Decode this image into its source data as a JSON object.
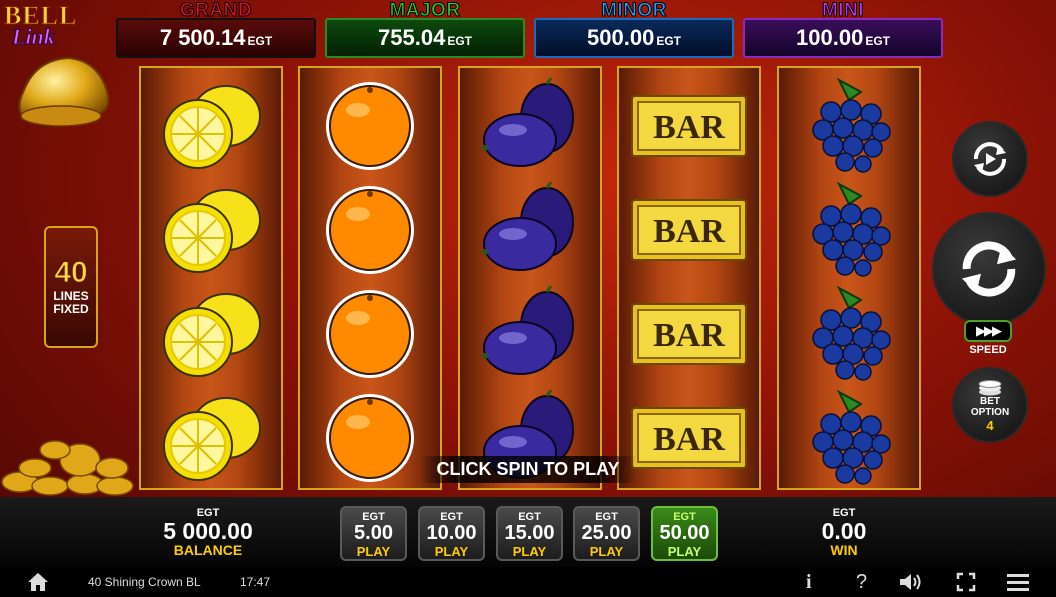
{
  "logo": {
    "line1": "BELL",
    "line2": "Link"
  },
  "jackpots": [
    {
      "name": "GRAND",
      "value": "7 500.14",
      "currency": "EGT",
      "label_color": "#e0102a",
      "bg": "#4a0808"
    },
    {
      "name": "MAJOR",
      "value": "755.04",
      "currency": "EGT",
      "label_color": "#2ad02a",
      "bg": "#0b3a0b"
    },
    {
      "name": "MINOR",
      "value": "500.00",
      "currency": "EGT",
      "label_color": "#1aa0ff",
      "bg": "#08224a"
    },
    {
      "name": "MINI",
      "value": "100.00",
      "currency": "EGT",
      "label_color": "#c030ff",
      "bg": "#2a0a4a"
    }
  ],
  "lines": {
    "count": "40",
    "label1": "LINES",
    "label2": "FIXED"
  },
  "reels": [
    [
      "lemon",
      "lemon",
      "lemon",
      "lemon"
    ],
    [
      "orange",
      "orange",
      "orange",
      "orange"
    ],
    [
      "plum",
      "plum",
      "plum",
      "plum"
    ],
    [
      "bar",
      "bar",
      "bar",
      "bar"
    ],
    [
      "grapes",
      "grapes",
      "grapes",
      "grapes"
    ]
  ],
  "bar_text": "BAR",
  "prompt": "CLICK SPIN TO PLAY",
  "balance": {
    "currency": "EGT",
    "value": "5 000.00",
    "label": "BALANCE"
  },
  "bets": [
    {
      "currency": "EGT",
      "value": "5.00",
      "label": "PLAY",
      "selected": false
    },
    {
      "currency": "EGT",
      "value": "10.00",
      "label": "PLAY",
      "selected": false
    },
    {
      "currency": "EGT",
      "value": "15.00",
      "label": "PLAY",
      "selected": false
    },
    {
      "currency": "EGT",
      "value": "25.00",
      "label": "PLAY",
      "selected": false
    },
    {
      "currency": "EGT",
      "value": "50.00",
      "label": "PLAY",
      "selected": true
    }
  ],
  "win": {
    "currency": "EGT",
    "value": "0.00",
    "label": "WIN"
  },
  "controls": {
    "speed_label": "SPEED",
    "bet_option_label1": "BET",
    "bet_option_label2": "OPTION",
    "bet_option_value": "4"
  },
  "status": {
    "game_name": "40 Shining Crown BL",
    "time": "17:47"
  },
  "icons": [
    "home-icon",
    "info-icon",
    "help-icon",
    "sound-icon",
    "fullscreen-icon",
    "menu-icon"
  ]
}
